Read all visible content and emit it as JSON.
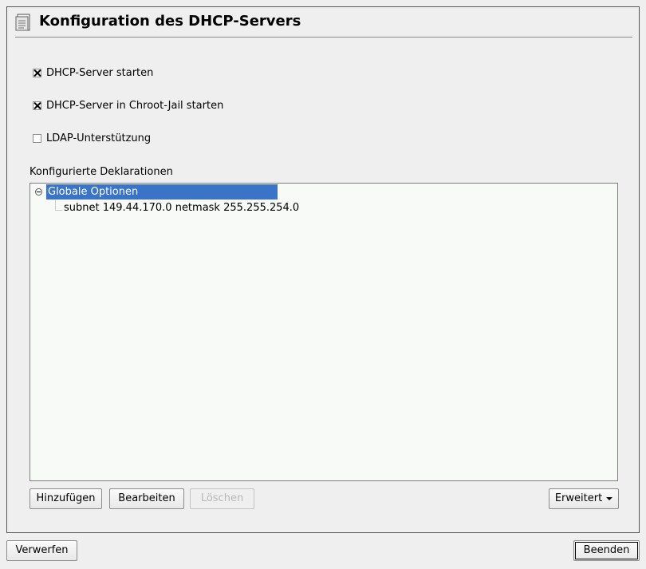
{
  "window": {
    "title": "Konfiguration des DHCP-Servers",
    "icon": "document-list-icon"
  },
  "options": [
    {
      "label": "DHCP-Server starten",
      "checked": true
    },
    {
      "label": "DHCP-Server in Chroot-Jail starten",
      "checked": true
    },
    {
      "label": "LDAP-Unterstützung",
      "checked": false
    }
  ],
  "declarations": {
    "label": "Konfigurierte Deklarationen",
    "tree": {
      "root": {
        "label": "Globale Optionen",
        "expanded": true,
        "selected": true
      },
      "children": [
        "subnet 149.44.170.0 netmask 255.255.254.0"
      ]
    }
  },
  "buttons": {
    "add": "Hinzufügen",
    "edit": "Bearbeiten",
    "delete": "Löschen",
    "advanced": "Erweitert",
    "discard": "Verwerfen",
    "finish": "Beenden"
  },
  "colors": {
    "selection": "#3a74c9",
    "tree_background": "#f7faf6",
    "window_background": "#efefef"
  }
}
